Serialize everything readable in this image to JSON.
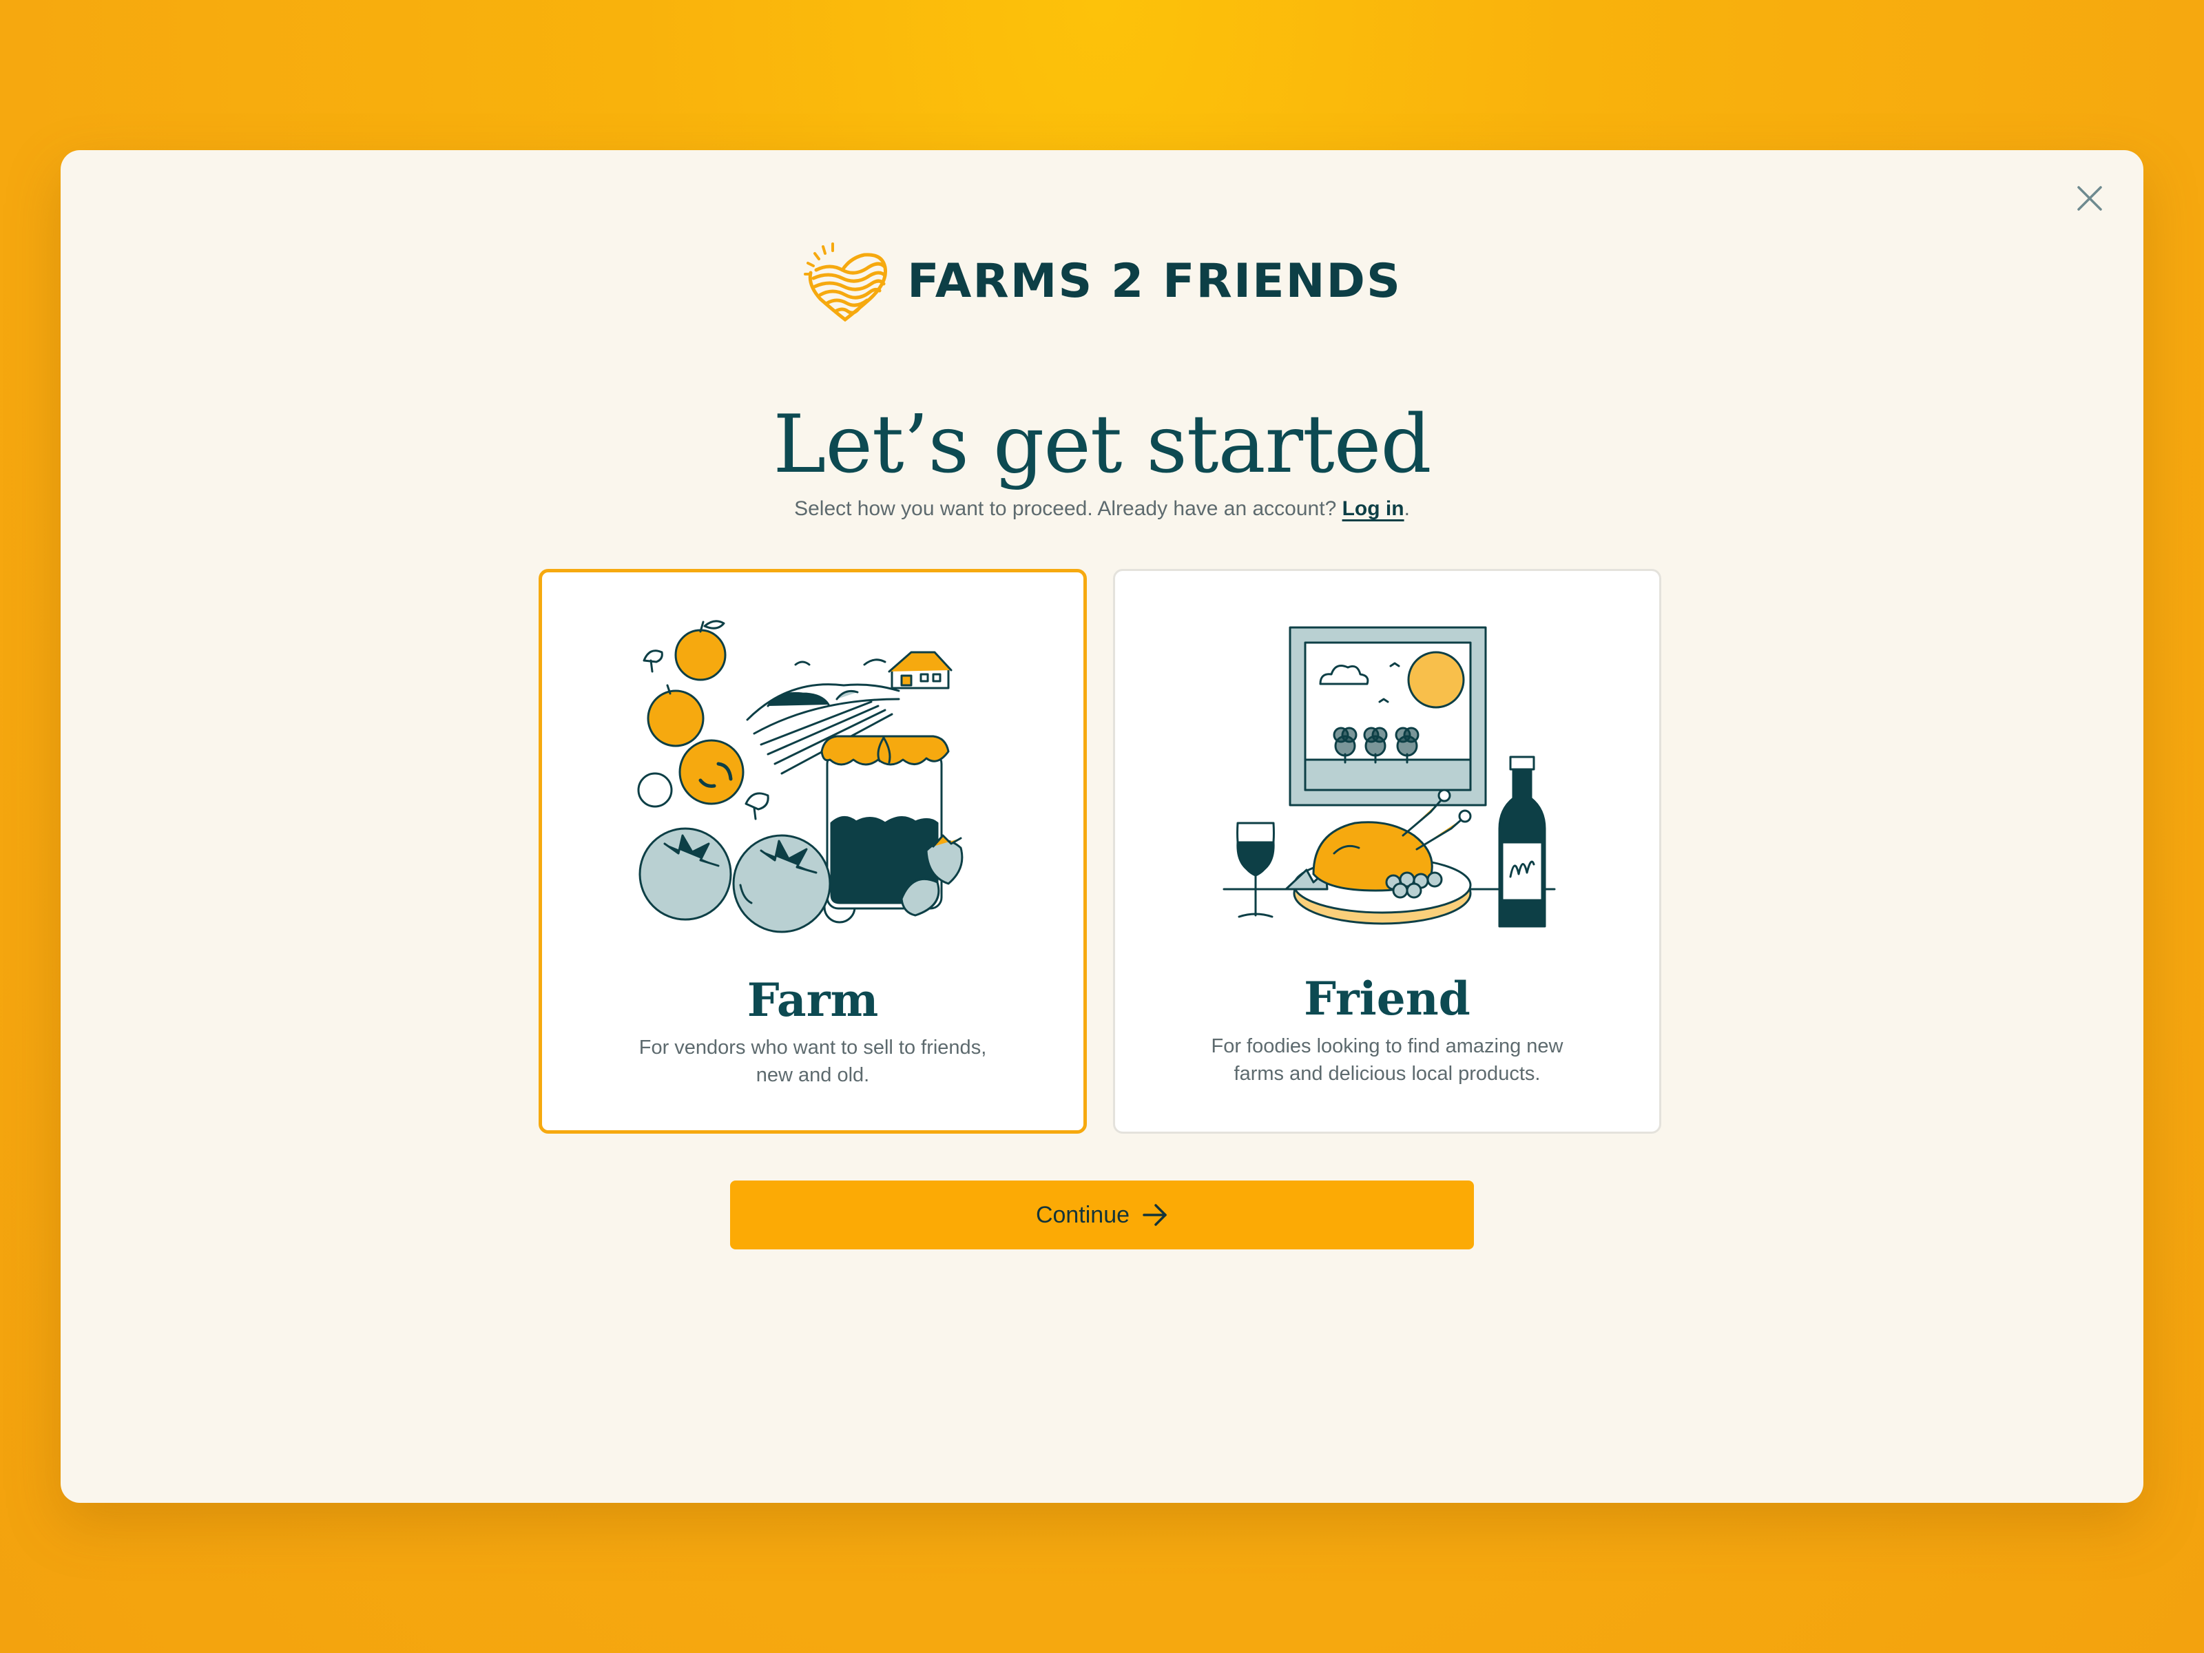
{
  "brand": {
    "name": "FARMS 2 FRIENDS",
    "logo_icon": "heart-sun-logo-icon"
  },
  "heading": {
    "title": "Let’s get started"
  },
  "subheading": {
    "text": "Select how you want to proceed. Already have an account? ",
    "login_link": "Log in",
    "suffix": "."
  },
  "cards": [
    {
      "id": "farm",
      "title": "Farm",
      "description": "For vendors who want to sell to friends, new and old.",
      "selected": true,
      "illustration": "farm-produce-illustration"
    },
    {
      "id": "friend",
      "title": "Friend",
      "description": "For foodies looking to find amazing new farms and delicious local products.",
      "selected": false,
      "illustration": "dinner-table-illustration"
    }
  ],
  "continue_button": {
    "label": "Continue",
    "icon": "arrow-right-icon"
  },
  "close_button": {
    "icon": "close-icon"
  },
  "colors": {
    "accent": "#fcaa05",
    "brand_dark": "#0d4a52",
    "background": "#faf6ed",
    "selected_border": "#f6a90f"
  }
}
